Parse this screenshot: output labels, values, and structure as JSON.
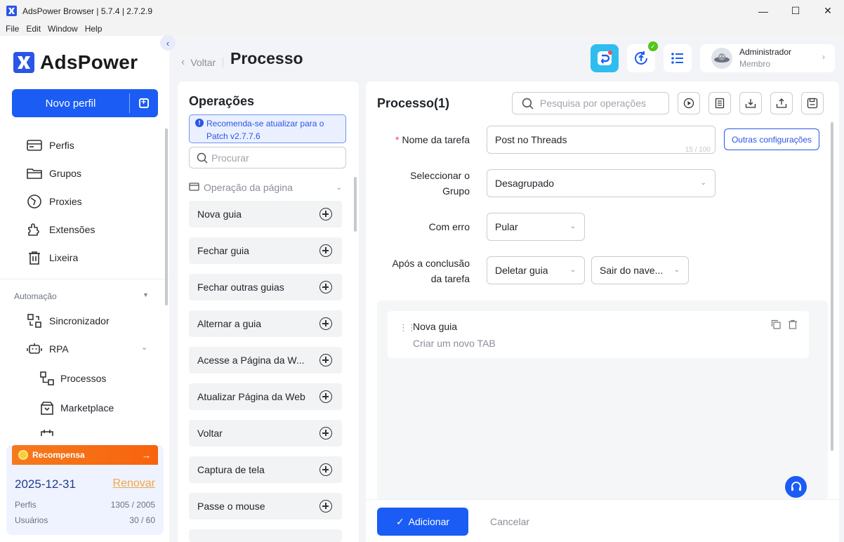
{
  "window": {
    "title": "AdsPower Browser | 5.7.4 | 2.7.2.9",
    "menu": [
      "File",
      "Edit",
      "Window",
      "Help"
    ]
  },
  "sidebar": {
    "logo": "AdsPower",
    "new_profile": "Novo perfil",
    "items": [
      {
        "label": "Perfis",
        "icon": "profiles-icon"
      },
      {
        "label": "Grupos",
        "icon": "folder-icon"
      },
      {
        "label": "Proxies",
        "icon": "proxy-icon"
      },
      {
        "label": "Extensões",
        "icon": "puzzle-icon"
      },
      {
        "label": "Lixeira",
        "icon": "trash-icon"
      }
    ],
    "automation_label": "Automação",
    "automation_items": [
      {
        "label": "Sincronizador",
        "icon": "sync-icon"
      },
      {
        "label": "RPA",
        "icon": "robot-icon"
      }
    ],
    "rpa_sub": [
      {
        "label": "Processos",
        "icon": "process-icon"
      },
      {
        "label": "Marketplace",
        "icon": "marketplace-icon"
      }
    ],
    "reward": {
      "title": "Recompensa",
      "date": "2025-12-31",
      "renew": "Renovar",
      "profiles_label": "Perfis",
      "profiles_value": "1305 / 2005",
      "users_label": "Usuários",
      "users_value": "30 / 60"
    }
  },
  "header": {
    "back": "Voltar",
    "title": "Processo",
    "user_name": "Administrador",
    "user_role": "Membro"
  },
  "operations": {
    "title": "Operações",
    "notice": "Recomenda-se atualizar para o Patch v2.7.7.6",
    "search_placeholder": "Procurar",
    "category": "Operação da página",
    "items": [
      "Nova guia",
      "Fechar guia",
      "Fechar outras guias",
      "Alternar a guia",
      "Acesse a Página da W...",
      "Atualizar Página da Web",
      "Voltar",
      "Captura de tela",
      "Passe o mouse"
    ]
  },
  "process": {
    "title": "Processo(1)",
    "search_placeholder": "Pesquisa por operações",
    "fields": {
      "task_name_label": "Nome da tarefa",
      "task_name_value": "Post no Threads",
      "task_name_count": "15 / 100",
      "group_label_1": "Seleccionar o",
      "group_label_2": "Grupo",
      "group_value": "Desagrupado",
      "error_label": "Com erro",
      "error_value": "Pular",
      "after_label_1": "Após a conclusão",
      "after_label_2": "da tarefa",
      "after_value_1": "Deletar guia",
      "after_value_2": "Sair do nave..."
    },
    "other_settings": "Outras configurações",
    "step": {
      "title": "Nova guia",
      "desc": "Criar um novo TAB"
    },
    "add_button": "Adicionar",
    "cancel_button": "Cancelar"
  },
  "colors": {
    "accent": "#1b5cf5",
    "reward": "#f8630e",
    "background": "#f3f4f7"
  }
}
